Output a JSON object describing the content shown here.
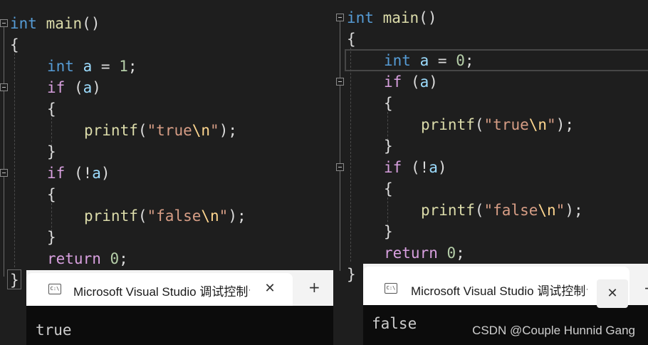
{
  "left_pane": {
    "code": {
      "l1": {
        "type": "int",
        "name": "main",
        "sig": "()"
      },
      "l2": {
        "brace": "{"
      },
      "l3": {
        "type": "int",
        "var": "a",
        "op": " = ",
        "val": "1",
        "semi": ";"
      },
      "l4": {
        "kw": "if",
        "open": " (",
        "var": "a",
        "close": ")"
      },
      "l5": {
        "brace": "{"
      },
      "l6": {
        "fn": "printf",
        "open": "(",
        "str1": "\"true",
        "esc": "\\n",
        "str2": "\"",
        "close": ");"
      },
      "l7": {
        "brace": "}"
      },
      "l8": {
        "kw": "if",
        "open": " (!",
        "var": "a",
        "close": ")"
      },
      "l9": {
        "brace": "{"
      },
      "l10": {
        "fn": "printf",
        "open": "(",
        "str1": "\"false",
        "esc": "\\n",
        "str2": "\"",
        "close": ");"
      },
      "l11": {
        "brace": "}"
      },
      "l12": {
        "kw": "return",
        "val": " 0",
        "semi": ";"
      },
      "l13": {
        "brace": "}"
      }
    },
    "console": {
      "tab_title": "Microsoft Visual Studio 调试控制台",
      "close": "✕",
      "new_tab": "+",
      "icon": "C:\\",
      "output": "true"
    }
  },
  "right_pane": {
    "code": {
      "l1": {
        "type": "int",
        "name": "main",
        "sig": "()"
      },
      "l2": {
        "brace": "{"
      },
      "l3": {
        "type": "int",
        "var": "a",
        "op": " = ",
        "val": "0",
        "semi": ";"
      },
      "l4": {
        "kw": "if",
        "open": " (",
        "var": "a",
        "close": ")"
      },
      "l5": {
        "brace": "{"
      },
      "l6": {
        "fn": "printf",
        "open": "(",
        "str1": "\"true",
        "esc": "\\n",
        "str2": "\"",
        "close": ");"
      },
      "l7": {
        "brace": "}"
      },
      "l8": {
        "kw": "if",
        "open": " (!",
        "var": "a",
        "close": ")"
      },
      "l9": {
        "brace": "{"
      },
      "l10": {
        "fn": "printf",
        "open": "(",
        "str1": "\"false",
        "esc": "\\n",
        "str2": "\"",
        "close": ");"
      },
      "l11": {
        "brace": "}"
      },
      "l12": {
        "kw": "return",
        "val": " 0",
        "semi": ";"
      },
      "l13": {
        "brace": "}"
      }
    },
    "console": {
      "tab_title": "Microsoft Visual Studio 调试控制台",
      "close": "✕",
      "new_tab": "+",
      "icon": "C:\\",
      "output": "false"
    }
  },
  "watermark": "CSDN @Couple Hunnid Gang",
  "colors": {
    "keyword": "#569cd6",
    "control": "#d8a0df",
    "function": "#dcdcaa",
    "variable": "#9cdcfe",
    "number": "#b5cea8",
    "string": "#d69d85",
    "escape": "#ffd68f",
    "background": "#1e1e1e"
  }
}
